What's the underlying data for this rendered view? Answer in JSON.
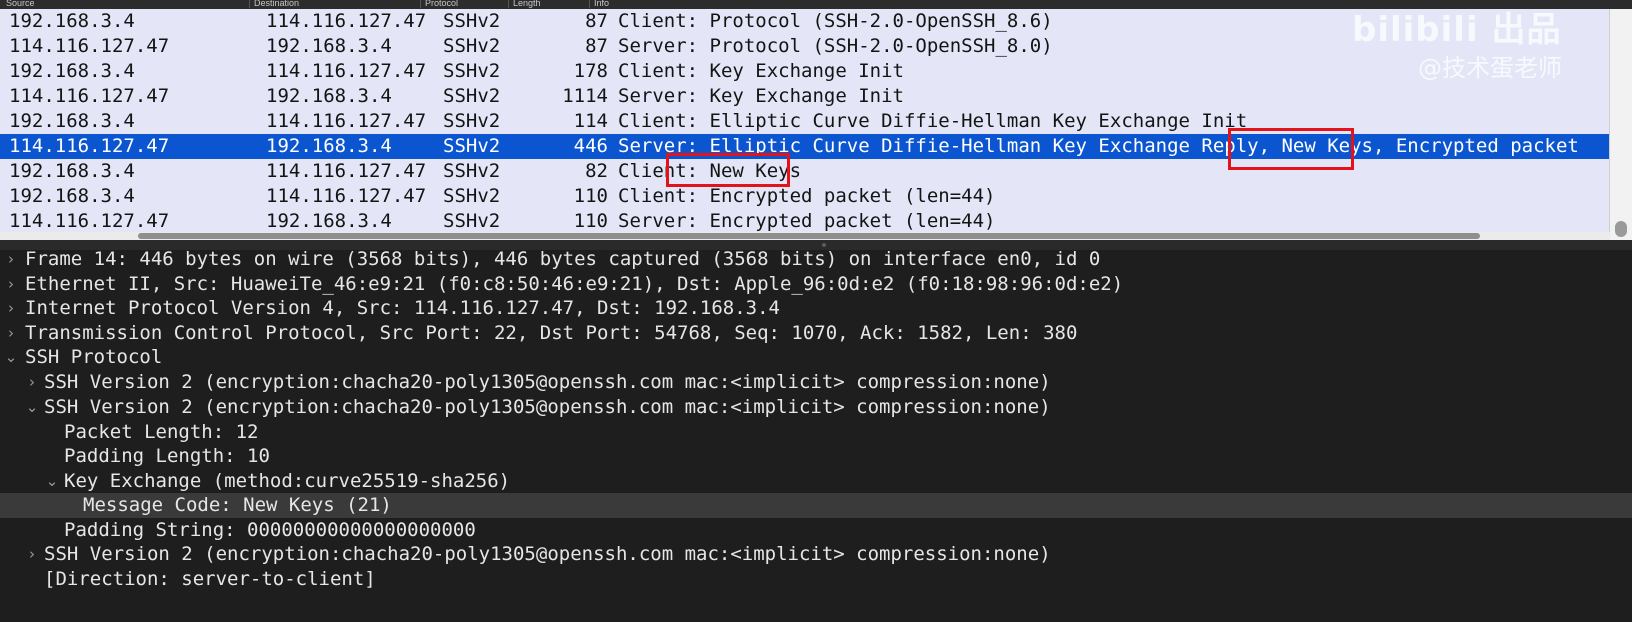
{
  "packet_list": {
    "columns": [
      "Source",
      "Destination",
      "Protocol",
      "Length",
      "Info"
    ],
    "rows": [
      {
        "src": "192.168.3.4",
        "dst": "114.116.127.47",
        "proto": "SSHv2",
        "len": "87",
        "info": "Client: Protocol (SSH-2.0-OpenSSH_8.6)"
      },
      {
        "src": "114.116.127.47",
        "dst": "192.168.3.4",
        "proto": "SSHv2",
        "len": "87",
        "info": "Server: Protocol (SSH-2.0-OpenSSH_8.0)"
      },
      {
        "src": "192.168.3.4",
        "dst": "114.116.127.47",
        "proto": "SSHv2",
        "len": "178",
        "info": "Client: Key Exchange Init"
      },
      {
        "src": "114.116.127.47",
        "dst": "192.168.3.4",
        "proto": "SSHv2",
        "len": "1114",
        "info": "Server: Key Exchange Init"
      },
      {
        "src": "192.168.3.4",
        "dst": "114.116.127.47",
        "proto": "SSHv2",
        "len": "114",
        "info": "Client: Elliptic Curve Diffie-Hellman Key Exchange Init"
      },
      {
        "src": "114.116.127.47",
        "dst": "192.168.3.4",
        "proto": "SSHv2",
        "len": "446",
        "info": "Server: Elliptic Curve Diffie-Hellman Key Exchange Reply, New Keys, Encrypted packet"
      },
      {
        "src": "192.168.3.4",
        "dst": "114.116.127.47",
        "proto": "SSHv2",
        "len": "82",
        "info": "Client: New Keys"
      },
      {
        "src": "192.168.3.4",
        "dst": "114.116.127.47",
        "proto": "SSHv2",
        "len": "110",
        "info": "Client: Encrypted packet (len=44)"
      },
      {
        "src": "114.116.127.47",
        "dst": "192.168.3.4",
        "proto": "SSHv2",
        "len": "110",
        "info": "Server: Encrypted packet (len=44)"
      }
    ]
  },
  "details": {
    "rows": [
      {
        "text": "Frame 14: 446 bytes on wire (3568 bits), 446 bytes captured (3568 bits) on interface en0, id 0",
        "arrow": "›"
      },
      {
        "text": "Ethernet II, Src: HuaweiTe_46:e9:21 (f0:c8:50:46:e9:21), Dst: Apple_96:0d:e2 (f0:18:98:96:0d:e2)",
        "arrow": "›"
      },
      {
        "text": "Internet Protocol Version 4, Src: 114.116.127.47, Dst: 192.168.3.4",
        "arrow": "›"
      },
      {
        "text": "Transmission Control Protocol, Src Port: 22, Dst Port: 54768, Seq: 1070, Ack: 1582, Len: 380",
        "arrow": "›"
      },
      {
        "text": "SSH Protocol",
        "arrow": "⌄"
      },
      {
        "text": "SSH Version 2 (encryption:chacha20-poly1305@openssh.com mac:<implicit> compression:none)",
        "arrow": "›"
      },
      {
        "text": "SSH Version 2 (encryption:chacha20-poly1305@openssh.com mac:<implicit> compression:none)",
        "arrow": "⌄"
      },
      {
        "text": "Packet Length: 12",
        "arrow": ""
      },
      {
        "text": "Padding Length: 10",
        "arrow": ""
      },
      {
        "text": "Key Exchange (method:curve25519-sha256)",
        "arrow": "⌄"
      },
      {
        "text": "Message Code: New Keys (21)",
        "arrow": ""
      },
      {
        "text": "Padding String: 00000000000000000000",
        "arrow": ""
      },
      {
        "text": "SSH Version 2 (encryption:chacha20-poly1305@openssh.com mac:<implicit> compression:none)",
        "arrow": "›"
      },
      {
        "text": "[Direction: server-to-client]",
        "arrow": ""
      }
    ]
  },
  "watermark": {
    "logo": "bilibili 出品",
    "user": "@技术蛋老师"
  }
}
